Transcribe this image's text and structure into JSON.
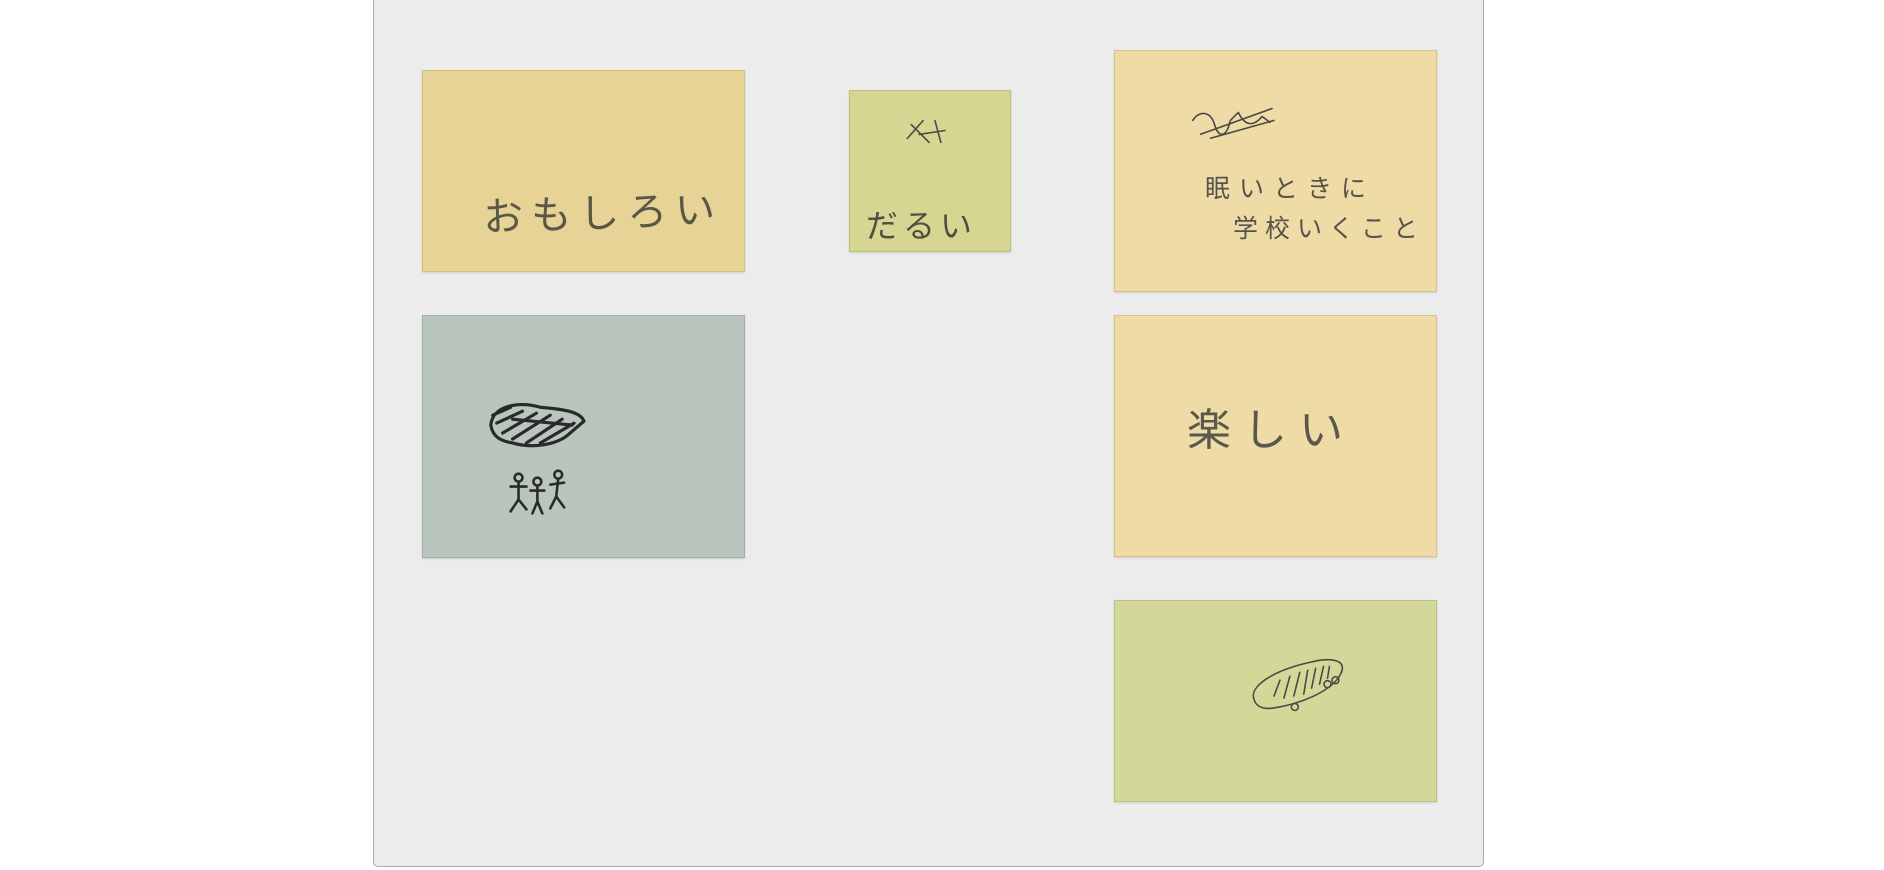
{
  "notes": [
    {
      "id": "omoshiroi",
      "text": "おもしろい",
      "color": "#e6d395"
    },
    {
      "id": "darui",
      "text": "だるい",
      "color": "#d5d692"
    },
    {
      "id": "nemui",
      "text_line1": "眠いときに",
      "text_line2": "学校いくこと",
      "color": "#efdba6"
    },
    {
      "id": "rain-cloud-drawing",
      "text": "",
      "color": "#b9c6bd"
    },
    {
      "id": "tanoshii",
      "text": "楽しい",
      "color": "#efdba6"
    },
    {
      "id": "skateboard-drawing",
      "text": "",
      "color": "#d3d797"
    }
  ]
}
